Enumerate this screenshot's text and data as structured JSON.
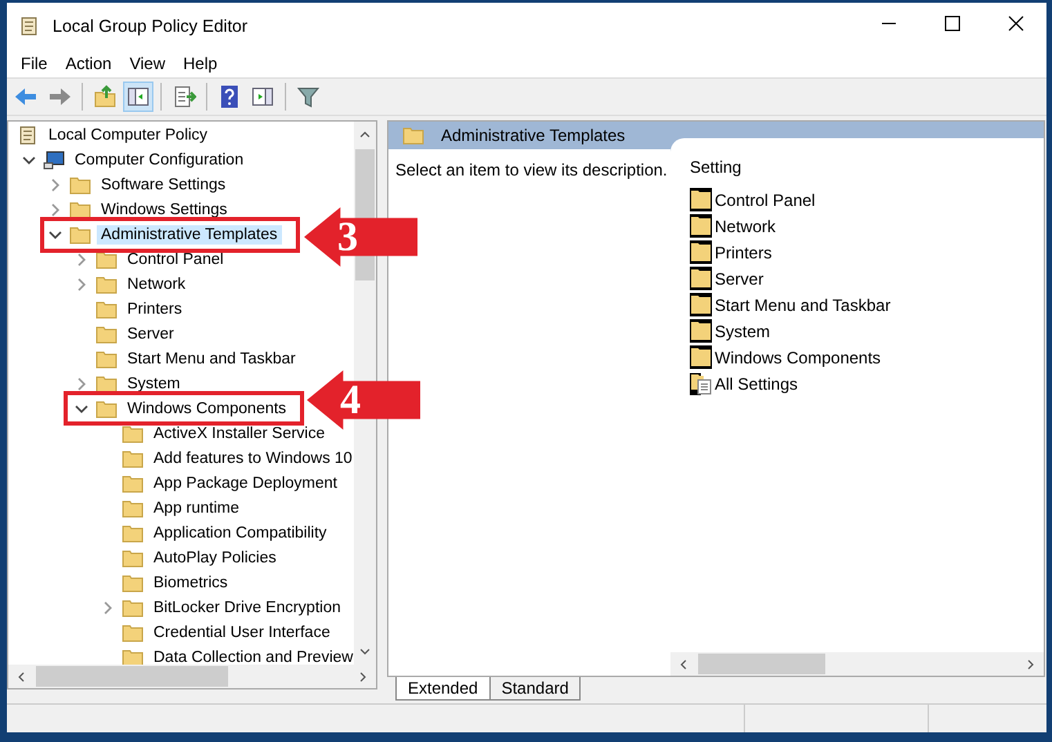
{
  "window": {
    "title": "Local Group Policy Editor"
  },
  "menu": [
    "File",
    "Action",
    "View",
    "Help"
  ],
  "toolbar": [
    {
      "kind": "back",
      "pressed": false
    },
    {
      "kind": "forward",
      "pressed": false
    },
    {
      "kind": "sep"
    },
    {
      "kind": "up",
      "pressed": false
    },
    {
      "kind": "tree",
      "pressed": true
    },
    {
      "kind": "sep"
    },
    {
      "kind": "export",
      "pressed": false
    },
    {
      "kind": "sep"
    },
    {
      "kind": "help",
      "pressed": false
    },
    {
      "kind": "pane",
      "pressed": false
    },
    {
      "kind": "sep"
    },
    {
      "kind": "filter",
      "pressed": false
    }
  ],
  "tree": {
    "label": "Local Computer Policy",
    "kind": "policy",
    "selected": false,
    "children": [
      {
        "label": "Computer Configuration",
        "kind": "computer",
        "expandable": true,
        "expanded": true,
        "selected": false,
        "children": [
          {
            "label": "Software Settings",
            "kind": "folder",
            "expandable": true,
            "expanded": false,
            "selected": false
          },
          {
            "label": "Windows Settings",
            "kind": "folder",
            "expandable": true,
            "expanded": false,
            "selected": false
          },
          {
            "label": "Administrative Templates",
            "kind": "folder",
            "expandable": true,
            "expanded": true,
            "selected": true,
            "children": [
              {
                "label": "Control Panel",
                "kind": "folder",
                "expandable": true,
                "expanded": false,
                "selected": false
              },
              {
                "label": "Network",
                "kind": "folder",
                "expandable": true,
                "expanded": false,
                "selected": false
              },
              {
                "label": "Printers",
                "kind": "folder",
                "expandable": false,
                "selected": false
              },
              {
                "label": "Server",
                "kind": "folder",
                "expandable": false,
                "selected": false
              },
              {
                "label": "Start Menu and Taskbar",
                "kind": "folder",
                "expandable": false,
                "selected": false
              },
              {
                "label": "System",
                "kind": "folder",
                "expandable": true,
                "expanded": false,
                "selected": false
              },
              {
                "label": "Windows Components",
                "kind": "folder",
                "expandable": true,
                "expanded": true,
                "selected": false,
                "children": [
                  {
                    "label": "ActiveX Installer Service",
                    "kind": "folder",
                    "expandable": false,
                    "selected": false
                  },
                  {
                    "label": "Add features to Windows 10",
                    "kind": "folder",
                    "expandable": false,
                    "selected": false
                  },
                  {
                    "label": "App Package Deployment",
                    "kind": "folder",
                    "expandable": false,
                    "selected": false
                  },
                  {
                    "label": "App runtime",
                    "kind": "folder",
                    "expandable": false,
                    "selected": false
                  },
                  {
                    "label": "Application Compatibility",
                    "kind": "folder",
                    "expandable": false,
                    "selected": false
                  },
                  {
                    "label": "AutoPlay Policies",
                    "kind": "folder",
                    "expandable": false,
                    "selected": false
                  },
                  {
                    "label": "Biometrics",
                    "kind": "folder",
                    "expandable": false,
                    "selected": false
                  },
                  {
                    "label": "BitLocker Drive Encryption",
                    "kind": "folder",
                    "expandable": true,
                    "expanded": false,
                    "selected": false
                  },
                  {
                    "label": "Credential User Interface",
                    "kind": "folder",
                    "expandable": false,
                    "selected": false
                  },
                  {
                    "label": "Data Collection and Preview",
                    "kind": "folder",
                    "expandable": false,
                    "selected": false
                  }
                ]
              }
            ]
          }
        ]
      }
    ]
  },
  "details": {
    "header": "Administrative Templates",
    "description": "Select an item to view its description.",
    "column": "Setting",
    "items": [
      {
        "label": "Control Panel",
        "kind": "folder"
      },
      {
        "label": "Network",
        "kind": "folder"
      },
      {
        "label": "Printers",
        "kind": "folder"
      },
      {
        "label": "Server",
        "kind": "folder"
      },
      {
        "label": "Start Menu and Taskbar",
        "kind": "folder"
      },
      {
        "label": "System",
        "kind": "folder"
      },
      {
        "label": "Windows Components",
        "kind": "folder"
      },
      {
        "label": "All Settings",
        "kind": "settings"
      }
    ],
    "tabs": [
      {
        "label": "Extended",
        "selected": true
      },
      {
        "label": "Standard",
        "selected": false
      }
    ]
  },
  "annotations": [
    {
      "number": "3"
    },
    {
      "number": "4"
    }
  ]
}
